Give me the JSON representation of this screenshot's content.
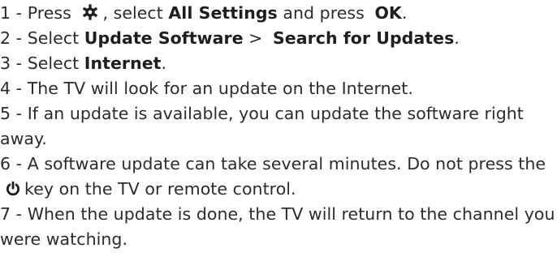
{
  "steps": [
    {
      "number": "1 - ",
      "parts": {
        "a": "Press ",
        "icon": "gear-icon",
        "b": ", select ",
        "c": "All Settings",
        "d": " and press ",
        "e": "OK",
        "f": "."
      }
    },
    {
      "number": "2 - ",
      "parts": {
        "a": "Select ",
        "b": "Update Software",
        "c": " > ",
        "d": "Search for Updates",
        "e": "."
      }
    },
    {
      "number": "3 - ",
      "parts": {
        "a": "Select ",
        "b": "Internet",
        "c": "."
      }
    },
    {
      "number": "4 - ",
      "text": "The TV will look for an update on the Internet."
    },
    {
      "number": "5 - ",
      "text": "If an update is available, you can update the software right away."
    },
    {
      "number": "6 - ",
      "parts": {
        "a": "A software update can take several minutes. Do not press the",
        "icon": "power-icon",
        "b": "key on the TV or remote control."
      }
    },
    {
      "number": "7 - ",
      "text": "When the update is done, the TV will return to the channel you were watching."
    }
  ],
  "colors": {
    "text": "#2b2b2b",
    "emphasis": "#1e1e1e",
    "icon": "#1e1e1e"
  }
}
